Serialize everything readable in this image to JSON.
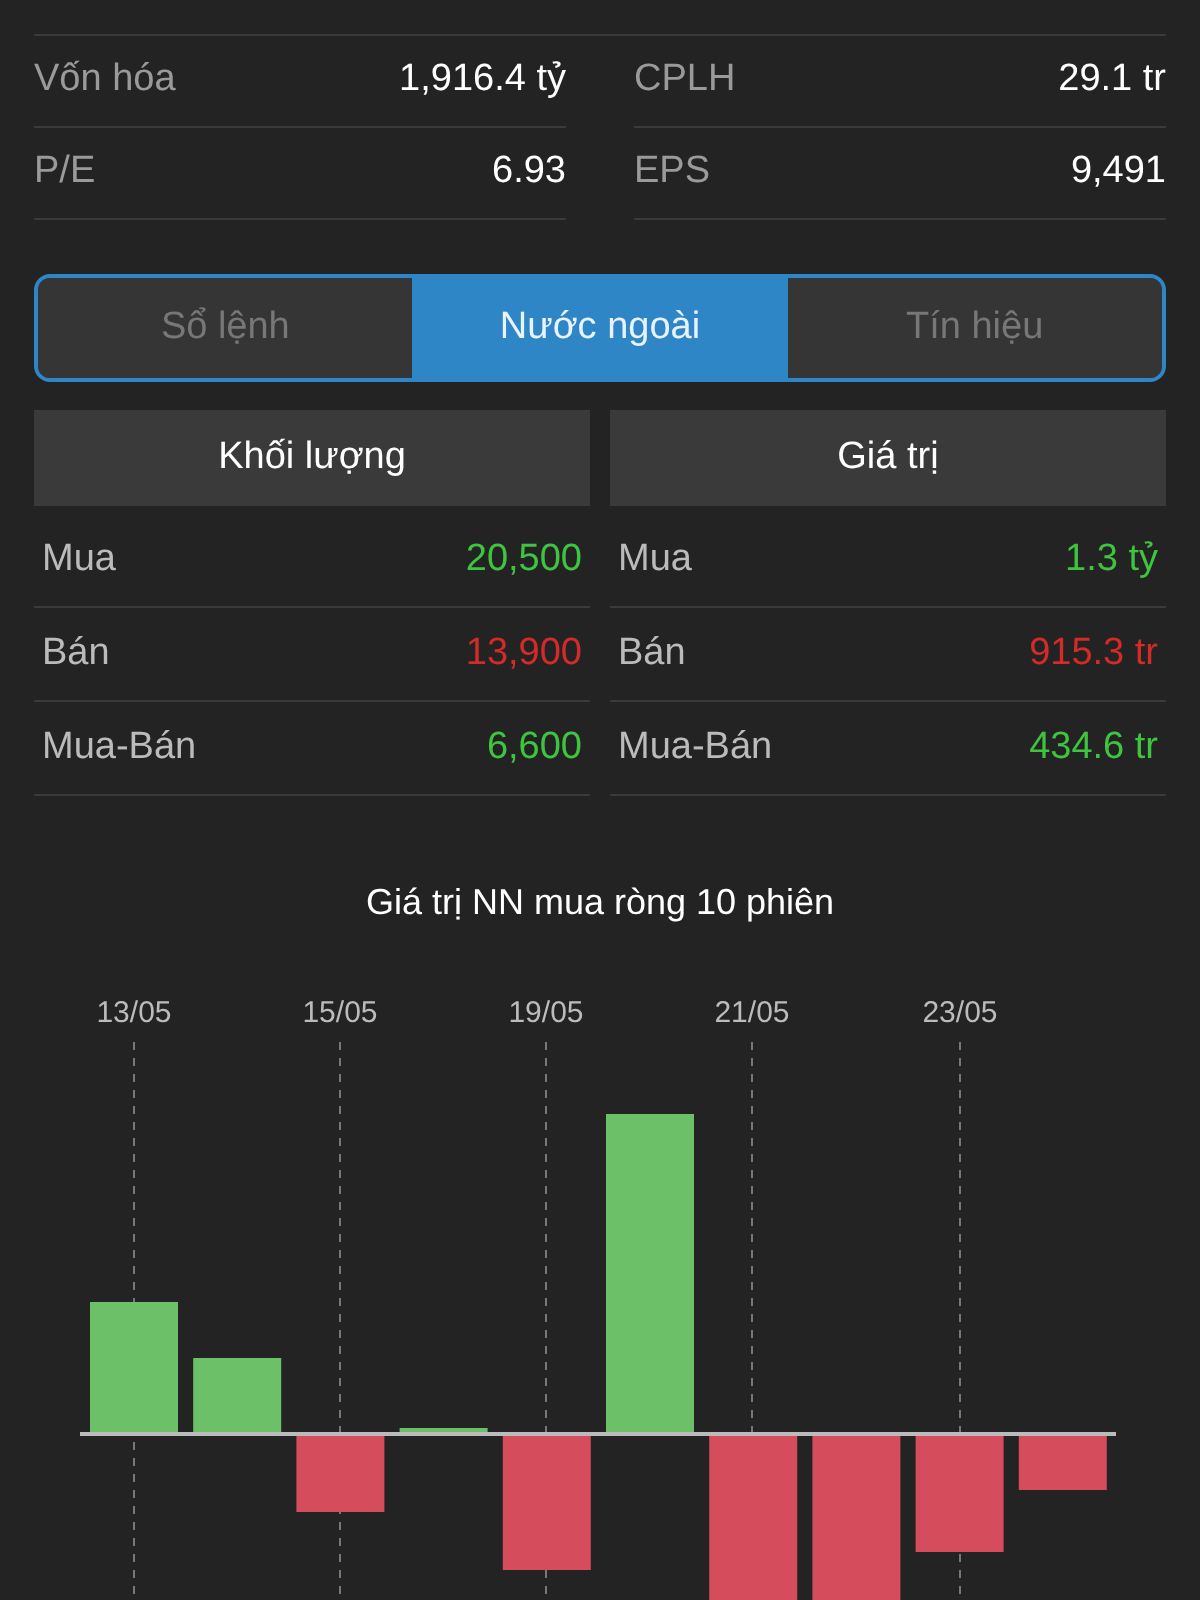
{
  "stats": [
    {
      "left": {
        "label": "Vốn hóa",
        "value": "1,916.4 tỷ"
      },
      "right": {
        "label": "CPLH",
        "value": "29.1 tr"
      }
    },
    {
      "left": {
        "label": "P/E",
        "value": "6.93"
      },
      "right": {
        "label": "EPS",
        "value": "9,491"
      }
    }
  ],
  "tabs": [
    {
      "label": "Sổ lệnh",
      "selected": false
    },
    {
      "label": "Nước ngoài",
      "selected": true
    },
    {
      "label": "Tín hiệu",
      "selected": false
    }
  ],
  "tables": [
    {
      "header": "Khối lượng",
      "rows": [
        {
          "label": "Mua",
          "value": "20,500",
          "color": "#3ec43e"
        },
        {
          "label": "Bán",
          "value": "13,900",
          "color": "#d32a2a"
        },
        {
          "label": "Mua-Bán",
          "value": "6,600",
          "color": "#3ec43e"
        }
      ]
    },
    {
      "header": "Giá trị",
      "rows": [
        {
          "label": "Mua",
          "value": "1.3 tỷ",
          "color": "#3ec43e"
        },
        {
          "label": "Bán",
          "value": "915.3 tr",
          "color": "#d32a2a"
        },
        {
          "label": "Mua-Bán",
          "value": "434.6 tr",
          "color": "#3ec43e"
        }
      ]
    }
  ],
  "chart": {
    "title": "Giá trị NN mua ròng 10 phiên",
    "dates": [
      "13/05",
      "15/05",
      "19/05",
      "21/05",
      "23/05"
    ]
  }
}
